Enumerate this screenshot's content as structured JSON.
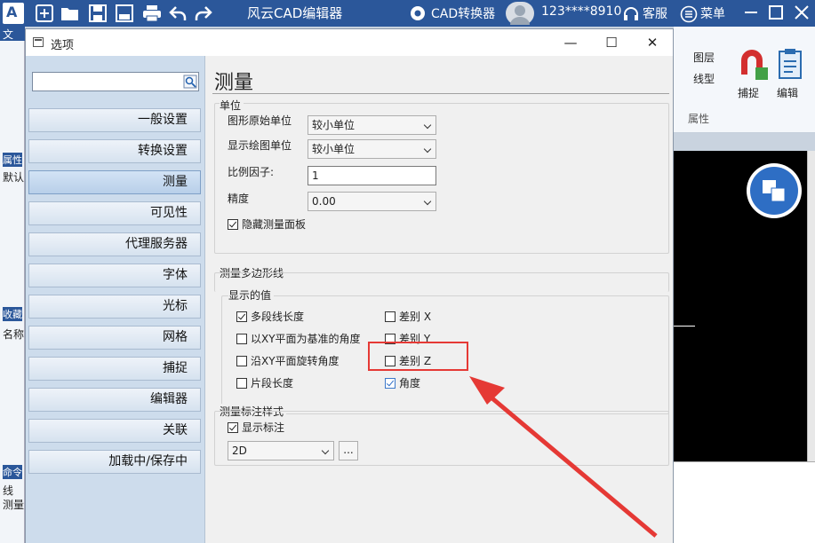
{
  "titlebar": {
    "app_title": "风云CAD编辑器",
    "converter": "CAD转换器",
    "user": "123****8910",
    "service": "客服",
    "menu": "菜单",
    "logo_text": "A"
  },
  "background": {
    "ribbon_layer": "图层",
    "ribbon_linetype": "线型",
    "ribbon_snap": "捕捉",
    "ribbon_edit": "编辑",
    "ribbon_properties": "属性",
    "left_tab_text": "文",
    "left_prop": "属性",
    "left_default": "默认",
    "left_fav": "收藏",
    "left_name": "名称",
    "left_cmd": "命令",
    "cmd_line": "线",
    "cmd_measure": "测量"
  },
  "dialog": {
    "title": "选项",
    "search_placeholder": "",
    "nav": [
      {
        "label": "一般设置"
      },
      {
        "label": "转换设置"
      },
      {
        "label": "测量"
      },
      {
        "label": "可见性"
      },
      {
        "label": "代理服务器"
      },
      {
        "label": "字体"
      },
      {
        "label": "光标"
      },
      {
        "label": "网格"
      },
      {
        "label": "捕捉"
      },
      {
        "label": "编辑器"
      },
      {
        "label": "关联"
      },
      {
        "label": "加载中/保存中"
      }
    ],
    "page_title": "测量",
    "units": {
      "group": "单位",
      "drawing_unit_label": "图形原始单位",
      "drawing_unit_value": "较小单位",
      "display_unit_label": "显示绘图单位",
      "display_unit_value": "较小单位",
      "scale_label": "比例因子:",
      "scale_value": "1",
      "precision_label": "精度",
      "precision_value": "0.00",
      "hide_panel": "隐藏测量面板"
    },
    "polyline": {
      "group": "测量多边形线",
      "shown_values": "显示的值",
      "polyline_length": "多段线长度",
      "xy_angle": "以XY平面为基准的角度",
      "xy_rotation": "沿XY平面旋转角度",
      "segment_length": "片段长度",
      "diff_x": "差别 X",
      "diff_y": "差别 Y",
      "diff_z": "差别 Z",
      "angle": "角度"
    },
    "dimension_style": {
      "group": "测量标注样式",
      "show_dimension": "显示标注",
      "style_value": "2D",
      "more": "..."
    }
  }
}
